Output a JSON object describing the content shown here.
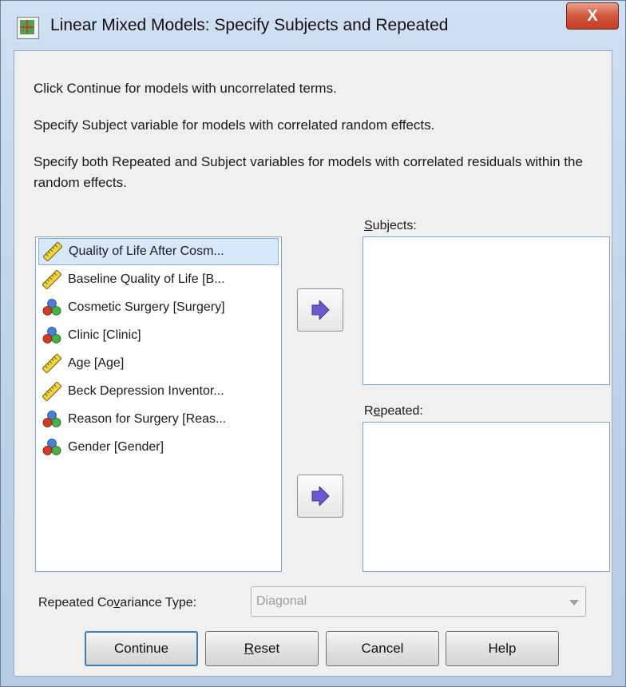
{
  "window": {
    "title": "Linear Mixed Models: Specify Subjects and Repeated",
    "close_label": "X"
  },
  "instructions": [
    "Click Continue for models with uncorrelated terms.",
    "Specify Subject variable for models with correlated random effects.",
    "Specify both Repeated and Subject variables for models with correlated residuals within the random effects."
  ],
  "variables": [
    {
      "label": "Quality of Life After Cosm...",
      "icon": "scale-icon",
      "selected": true
    },
    {
      "label": "Baseline Quality of Life [B...",
      "icon": "scale-icon",
      "selected": false
    },
    {
      "label": "Cosmetic Surgery [Surgery]",
      "icon": "nominal-icon",
      "selected": false
    },
    {
      "label": "Clinic [Clinic]",
      "icon": "nominal-icon",
      "selected": false
    },
    {
      "label": "Age [Age]",
      "icon": "scale-icon",
      "selected": false
    },
    {
      "label": "Beck Depression Inventor...",
      "icon": "scale-icon",
      "selected": false
    },
    {
      "label": "Reason for Surgery [Reas...",
      "icon": "nominal-icon",
      "selected": false
    },
    {
      "label": "Gender [Gender]",
      "icon": "nominal-icon",
      "selected": false
    }
  ],
  "subjects": {
    "label_first": "S",
    "label_rest": "ubjects:",
    "items": []
  },
  "repeated": {
    "label_first": "R",
    "label_mid": "e",
    "label_under": "p",
    "label_rest": "eated:",
    "items": []
  },
  "covariance": {
    "label_pre": "Repeated Co",
    "label_under": "v",
    "label_post": "ariance Type:",
    "value": "Diagonal"
  },
  "buttons": {
    "continue": "Continue",
    "reset_under": "R",
    "reset_rest": "eset",
    "cancel": "Cancel",
    "help": "Help"
  },
  "colors": {
    "accent": "#3c7fb1",
    "arrow": "#6a5acd",
    "selection": "#d7e8fa",
    "close": "#c9452b"
  }
}
